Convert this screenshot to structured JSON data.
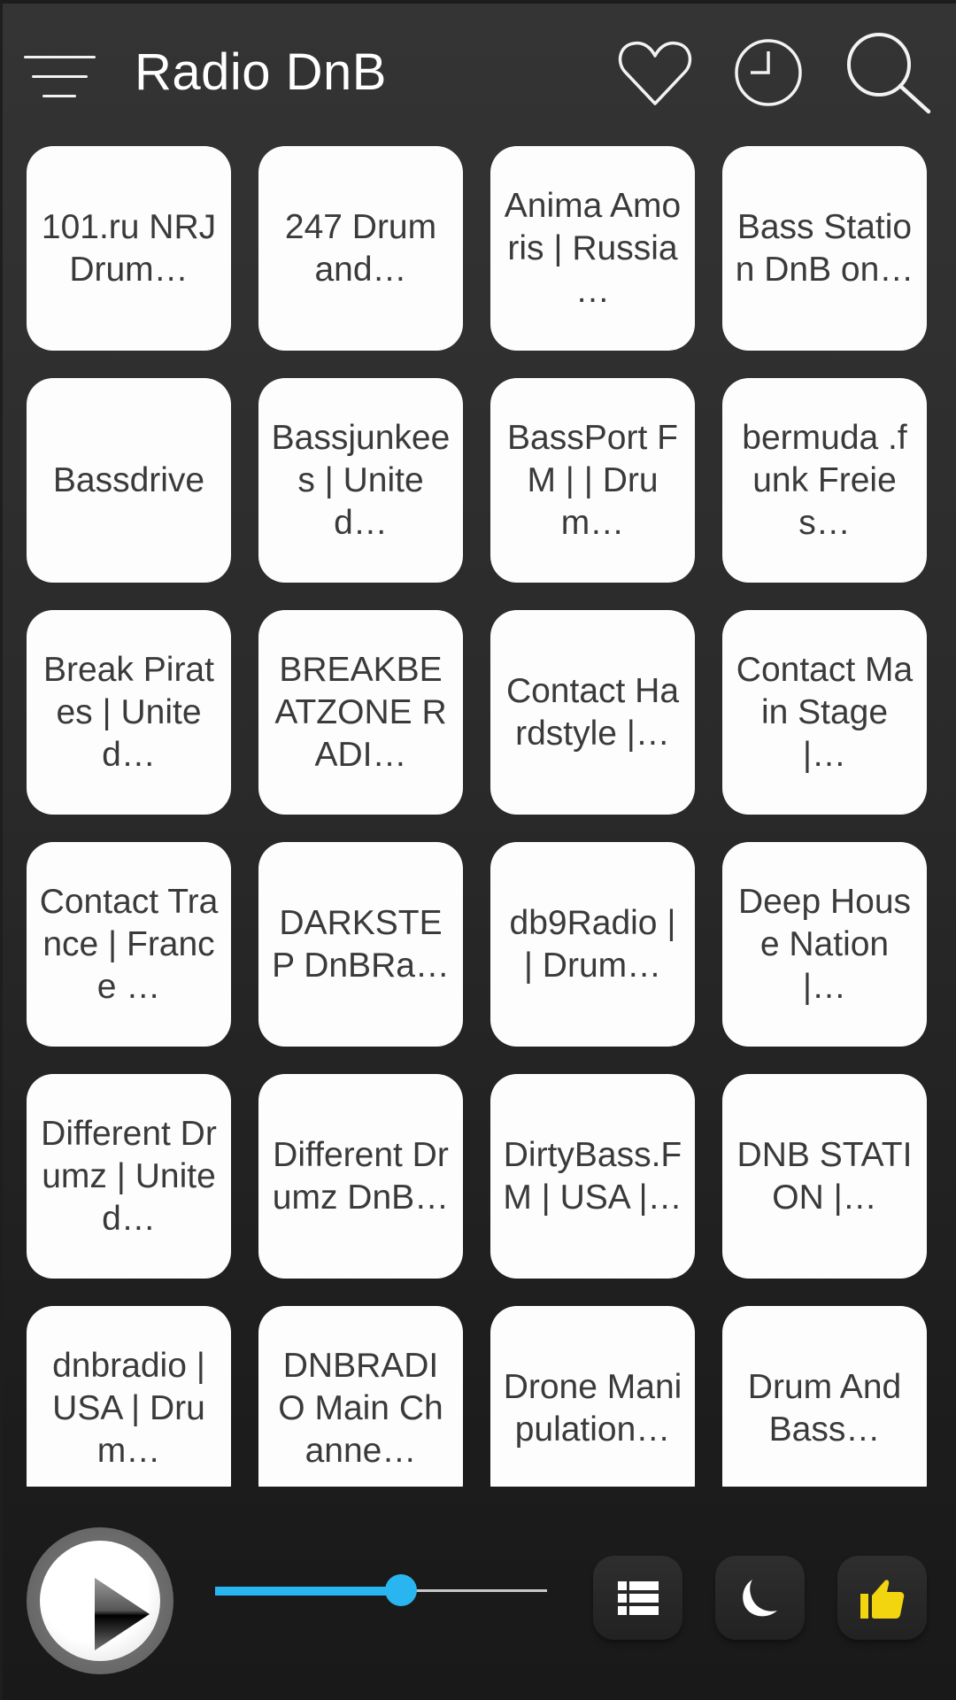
{
  "header": {
    "title": "Radio DnB",
    "icons": {
      "menu": "menu-icon",
      "favorites": "heart-icon",
      "history": "clock-icon",
      "search": "search-icon"
    }
  },
  "stations": [
    "101.ru NRJ Drum…",
    "247 Drum and…",
    "Anima Amoris | Russia …",
    "Bass Station DnB on…",
    "Bassdrive",
    "Bassjunkees | United…",
    "BassPort FM | | Drum…",
    "bermuda .funk Freies…",
    "Break Pirates | United…",
    "BREAKBEATZONE RADI…",
    "Contact Hardstyle |…",
    "Contact Main Stage |…",
    "Contact Trance | France …",
    "DARKSTEP DnBRa…",
    "db9Radio | | Drum…",
    "Deep House Nation |…",
    "Different Drumz | United…",
    "Different Drumz DnB…",
    "DirtyBass.FM | USA |…",
    "DNB STATION |…",
    "dnbradio | USA | Drum…",
    "DNBRADIO Main Channe…",
    "Drone Manipulation…",
    "Drum And Bass…"
  ],
  "player": {
    "play_icon": "play-icon",
    "volume_percent": 56,
    "buttons": {
      "list": "list-icon",
      "sleep_timer": "moon-icon",
      "rate": "thumbs-up-icon"
    },
    "colors": {
      "accent": "#29b6f0",
      "like": "#f2d40f",
      "track": "#c8c8c8"
    }
  }
}
